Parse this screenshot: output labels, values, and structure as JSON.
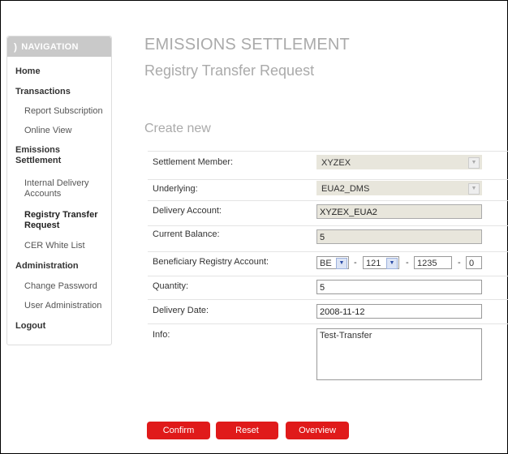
{
  "nav": {
    "header": "NAVIGATION",
    "items": [
      {
        "label": "Home"
      },
      {
        "label": "Transactions"
      },
      {
        "label": "Report Subscription"
      },
      {
        "label": "Online View"
      },
      {
        "label": "Emissions Settlement"
      },
      {
        "label": "Internal Delivery Accounts"
      },
      {
        "label": "Registry Transfer Request"
      },
      {
        "label": "CER White List"
      },
      {
        "label": "Administration"
      },
      {
        "label": "Change Password"
      },
      {
        "label": "User Administration"
      },
      {
        "label": "Logout"
      }
    ]
  },
  "page": {
    "title": "EMISSIONS SETTLEMENT",
    "subtitle": "Registry Transfer Request",
    "section": "Create new"
  },
  "form": {
    "settlement_member": {
      "label": "Settlement Member:",
      "value": "XYZEX"
    },
    "underlying": {
      "label": "Underlying:",
      "value": "EUA2_DMS"
    },
    "delivery_account": {
      "label": "Delivery Account:",
      "value": "XYZEX_EUA2"
    },
    "current_balance": {
      "label": "Current Balance:",
      "value": "5"
    },
    "beneficiary": {
      "label": "Beneficiary Registry Account:",
      "country": "BE",
      "type": "121",
      "account": "1235",
      "check": "0"
    },
    "quantity": {
      "label": "Quantity:",
      "value": "5"
    },
    "delivery_date": {
      "label": "Delivery Date:",
      "value": "2008-11-12"
    },
    "info": {
      "label": "Info:",
      "value": "Test-Transfer"
    }
  },
  "buttons": {
    "confirm": "Confirm",
    "reset": "Reset",
    "overview": "Overview"
  },
  "colors": {
    "accent": "#e01a1a",
    "readonly_bg": "#e8e6dc"
  }
}
